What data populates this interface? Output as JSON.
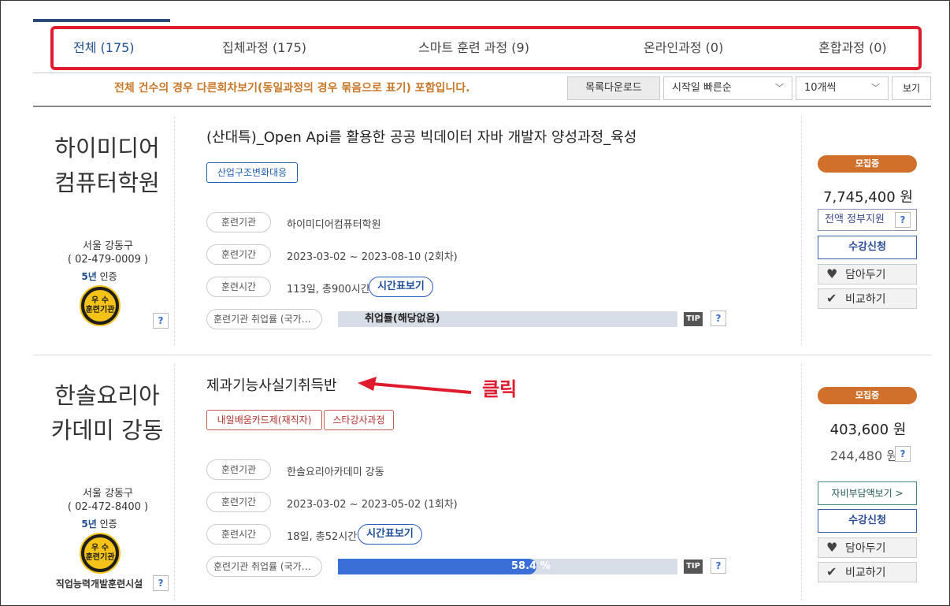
{
  "tabs": [
    {
      "label": "전체 (175)"
    },
    {
      "label": "집체과정 (175)"
    },
    {
      "label": "스마트 훈련 과정 (9)"
    },
    {
      "label": "온라인과정 (0)"
    },
    {
      "label": "혼합과정 (0)"
    }
  ],
  "toolbar": {
    "notice": "전체 건수의 경우 다른회차보기(동일과정의 경우 묶음으로 표기) 포함입니다.",
    "download_label": "목록다운로드",
    "sort_value": "시작일 빠른순",
    "page_size_value": "10개씩",
    "view_label": "보기"
  },
  "courses": [
    {
      "org_line1": "하이미디어",
      "org_line2": "컴퓨터학원",
      "region": "서울 강동구",
      "phone": "( 02-479-0009 )",
      "cert_years": "5년",
      "cert_label": "인증",
      "medal_line1": "우 수",
      "medal_line2": "훈련기관",
      "help": "?",
      "title": "(산대특)_Open Api를 활용한 공공 빅데이터 자바 개발자 양성과정_육성",
      "tags": [
        "산업구조변화대응"
      ],
      "institution_label": "훈련기관",
      "institution": "하이미디어컴퓨터학원",
      "period_label": "훈련기간",
      "period": "2023-03-02 ~ 2023-08-10 (2회차)",
      "hours_label": "훈련시간",
      "hours": "113일, 총900시간",
      "timetable_label": "시간표보기",
      "employment_label": "훈련기관 취업률 (국가직무능력표준)",
      "employment_text": "취업률(해당없음)",
      "employment_rate": 0,
      "tip": "TIP",
      "status": "모집중",
      "price": "7,745,400 원",
      "gov_support": "전액 정부지원",
      "apply_label": "수강신청",
      "save_label": "담아두기",
      "compare_label": "비교하기"
    },
    {
      "org_line1": "한솔요리아",
      "org_line2": "카데미 강동",
      "region": "서울 강동구",
      "phone": "( 02-472-8400 )",
      "cert_years": "5년",
      "cert_label": "인증",
      "medal_line1": "우 수",
      "medal_line2": "훈련기관",
      "facility": "직업능력개발훈련시설",
      "help": "?",
      "title": "제과기능사실기취득반",
      "tags": [
        "내일배움카드제(재직자)",
        "스타강사과정"
      ],
      "institution_label": "훈련기관",
      "institution": "한솔요리아카데미 강동",
      "period_label": "훈련기간",
      "period": "2023-03-02 ~ 2023-05-02 (1회차)",
      "hours_label": "훈련시간",
      "hours": "18일, 총52시간",
      "timetable_label": "시간표보기",
      "employment_label": "훈련기관 취업률 (국가직무능력표준)",
      "employment_text": "58.4 %",
      "employment_rate": 58.4,
      "tip": "TIP",
      "status": "모집중",
      "price": "403,600 원",
      "self_price": "244,480 원",
      "self_pay_label": "자비부담액보기 >",
      "apply_label": "수강신청",
      "save_label": "담아두기",
      "compare_label": "비교하기"
    }
  ],
  "annotation": {
    "click_text": "클릭",
    "color": "#e01b2e"
  }
}
